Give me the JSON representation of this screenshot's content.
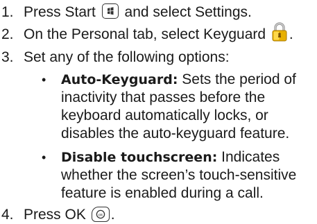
{
  "steps": [
    {
      "num": "1.",
      "before": "Press Start",
      "icon": "windows-start-key-icon",
      "after": " and select Settings."
    },
    {
      "num": "2.",
      "before": "On the Personal tab, select Keyguard",
      "icon": "padlock-icon",
      "after": "."
    },
    {
      "num": "3.",
      "text": "Set any of the following options:"
    },
    {
      "num": "4.",
      "before": "Press OK",
      "icon": "ok-key-icon",
      "after": "."
    }
  ],
  "options": [
    {
      "term": "Auto-Keyguard:",
      "lines": [
        " Sets the period of",
        "inactivity that passes before the",
        "keyboard automatically locks, or",
        "disables the auto-keyguard feature."
      ]
    },
    {
      "term": "Disable touchscreen:",
      "lines": [
        " Indicates",
        "whether the screen’s touch-sensitive",
        "feature is enabled during a call."
      ]
    }
  ],
  "bullet": "•",
  "colors": {
    "text": "#1a1a1a",
    "lock_body": "#e8b000",
    "lock_shackle": "#9a9a9a"
  }
}
